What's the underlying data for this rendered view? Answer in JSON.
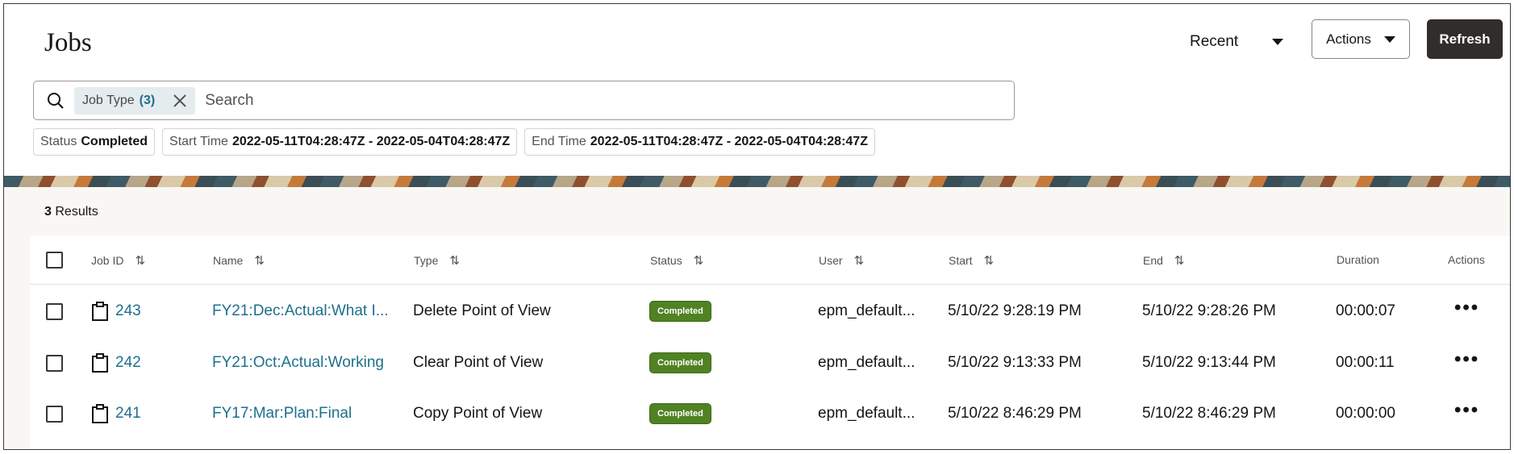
{
  "page": {
    "title": "Jobs"
  },
  "header": {
    "recent_label": "Recent",
    "actions_label": "Actions",
    "refresh_label": "Refresh"
  },
  "search": {
    "chip_label": "Job Type",
    "chip_count": "(3)",
    "placeholder": "Search"
  },
  "filters": [
    {
      "label": "Status",
      "value": "Completed"
    },
    {
      "label": "Start Time",
      "value": "2022-05-11T04:28:47Z - 2022-05-04T04:28:47Z"
    },
    {
      "label": "End Time",
      "value": "2022-05-11T04:28:47Z - 2022-05-04T04:28:47Z"
    }
  ],
  "results": {
    "count": "3",
    "label": "Results"
  },
  "columns": {
    "job_id": "Job ID",
    "name": "Name",
    "type": "Type",
    "status": "Status",
    "user": "User",
    "start": "Start",
    "end": "End",
    "duration": "Duration",
    "actions": "Actions"
  },
  "rows": [
    {
      "id": "243",
      "name": "FY21:Dec:Actual:What I...",
      "type": "Delete Point of View",
      "status": "Completed",
      "user": "epm_default...",
      "start": "5/10/22 9:28:19 PM",
      "end": "5/10/22 9:28:26 PM",
      "duration": "00:00:07",
      "actions": "•••"
    },
    {
      "id": "242",
      "name": "FY21:Oct:Actual:Working",
      "type": "Clear Point of View",
      "status": "Completed",
      "user": "epm_default...",
      "start": "5/10/22 9:13:33 PM",
      "end": "5/10/22 9:13:44 PM",
      "duration": "00:00:11",
      "actions": "•••"
    },
    {
      "id": "241",
      "name": "FY17:Mar:Plan:Final",
      "type": "Copy Point of View",
      "status": "Completed",
      "user": "epm_default...",
      "start": "5/10/22 8:46:29 PM",
      "end": "5/10/22 8:46:29 PM",
      "duration": "00:00:00",
      "actions": "•••"
    }
  ],
  "colors": {
    "accent_link": "#1e6f8c",
    "status_completed": "#508223",
    "refresh_bg": "#312d2a"
  }
}
